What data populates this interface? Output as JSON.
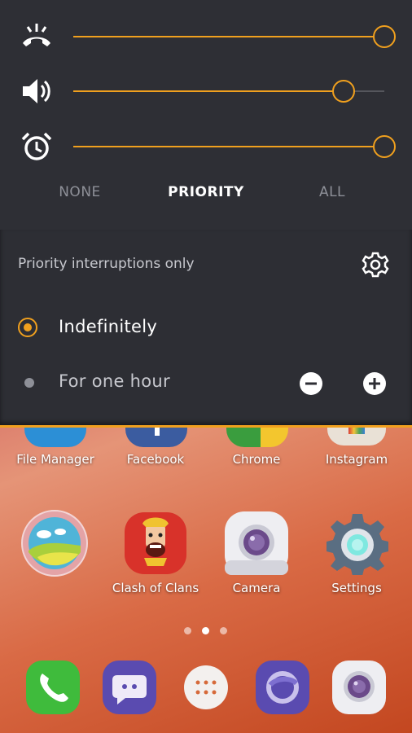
{
  "volume_panel": {
    "sliders": [
      {
        "name": "ringer",
        "icon": "ringer-off-icon",
        "level": 1.0
      },
      {
        "name": "media",
        "icon": "speaker-icon",
        "level": 0.87
      },
      {
        "name": "alarm",
        "icon": "alarm-clock-icon",
        "level": 1.0
      }
    ],
    "modes": [
      "NONE",
      "PRIORITY",
      "ALL"
    ],
    "active_mode": "PRIORITY"
  },
  "priority_panel": {
    "title": "Priority interruptions only",
    "settings_icon": "gear-icon",
    "options": [
      {
        "label": "Indefinitely",
        "selected": true
      },
      {
        "label": "For one hour",
        "selected": false
      }
    ],
    "decrement_icon": "minus-circle-icon",
    "increment_icon": "plus-circle-icon"
  },
  "home": {
    "top_row_labels": [
      "File Manager",
      "Facebook",
      "Chrome",
      "Instagram"
    ],
    "second_row": [
      {
        "label": "",
        "icon": "gallery-icon"
      },
      {
        "label": "Clash of Clans",
        "icon": "clash-of-clans-icon"
      },
      {
        "label": "Camera",
        "icon": "camera-icon"
      },
      {
        "label": "Settings",
        "icon": "settings-gear-icon"
      }
    ],
    "page_count": 3,
    "current_page": 2,
    "dock": [
      "phone-icon",
      "messaging-icon",
      "app-drawer-icon",
      "browser-icon",
      "camera-icon"
    ]
  },
  "colors": {
    "accent": "#f0a01e",
    "panel_bg": "#2e2f35",
    "inactive_text": "#8e9098"
  }
}
